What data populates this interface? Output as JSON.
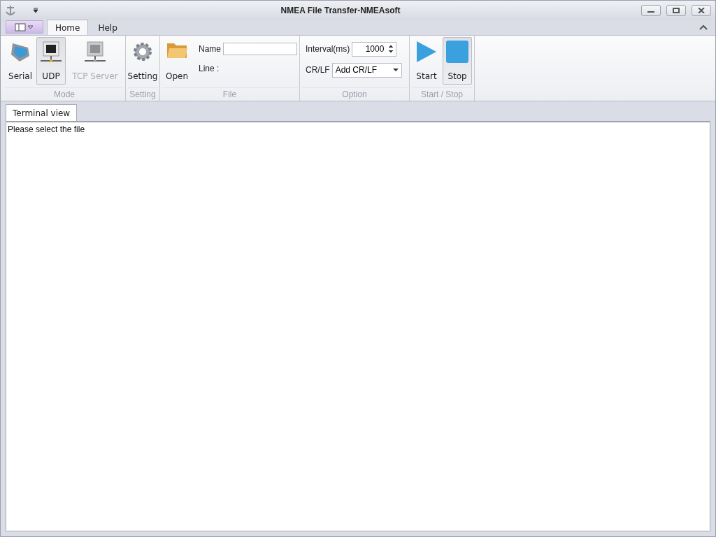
{
  "window": {
    "title": "NMEA File Transfer-NMEAsoft"
  },
  "tabs": [
    {
      "label": "Home",
      "selected": true
    },
    {
      "label": "Help",
      "selected": false
    }
  ],
  "ribbon": {
    "groups": [
      {
        "kind": "buttons",
        "caption": "Mode",
        "buttons": [
          {
            "label": "Serial",
            "selected": false,
            "disabled": false
          },
          {
            "label": "UDP",
            "selected": true,
            "disabled": false
          },
          {
            "label": "TCP Server",
            "selected": false,
            "disabled": true
          }
        ]
      },
      {
        "kind": "buttons",
        "caption": "Setting",
        "buttons": [
          {
            "label": "Setting",
            "selected": false,
            "disabled": false
          }
        ]
      },
      {
        "kind": "file",
        "caption": "File",
        "button": {
          "label": "Open",
          "selected": false,
          "disabled": false
        },
        "name_label": "Name",
        "line_label": "Line :"
      },
      {
        "kind": "option",
        "caption": "Option",
        "interval_label": "Interval(ms)",
        "interval_value": "1000",
        "crlf_label": "CR/LF",
        "crlf_value": "Add CR/LF"
      },
      {
        "kind": "buttons",
        "caption": "Start / Stop",
        "buttons": [
          {
            "label": "Start",
            "selected": false,
            "disabled": false
          },
          {
            "label": "Stop",
            "selected": true,
            "disabled": false
          }
        ]
      }
    ]
  },
  "document_tabs": [
    {
      "label": "Terminal view",
      "selected": true
    }
  ],
  "terminal": {
    "text": "Please select the file"
  }
}
